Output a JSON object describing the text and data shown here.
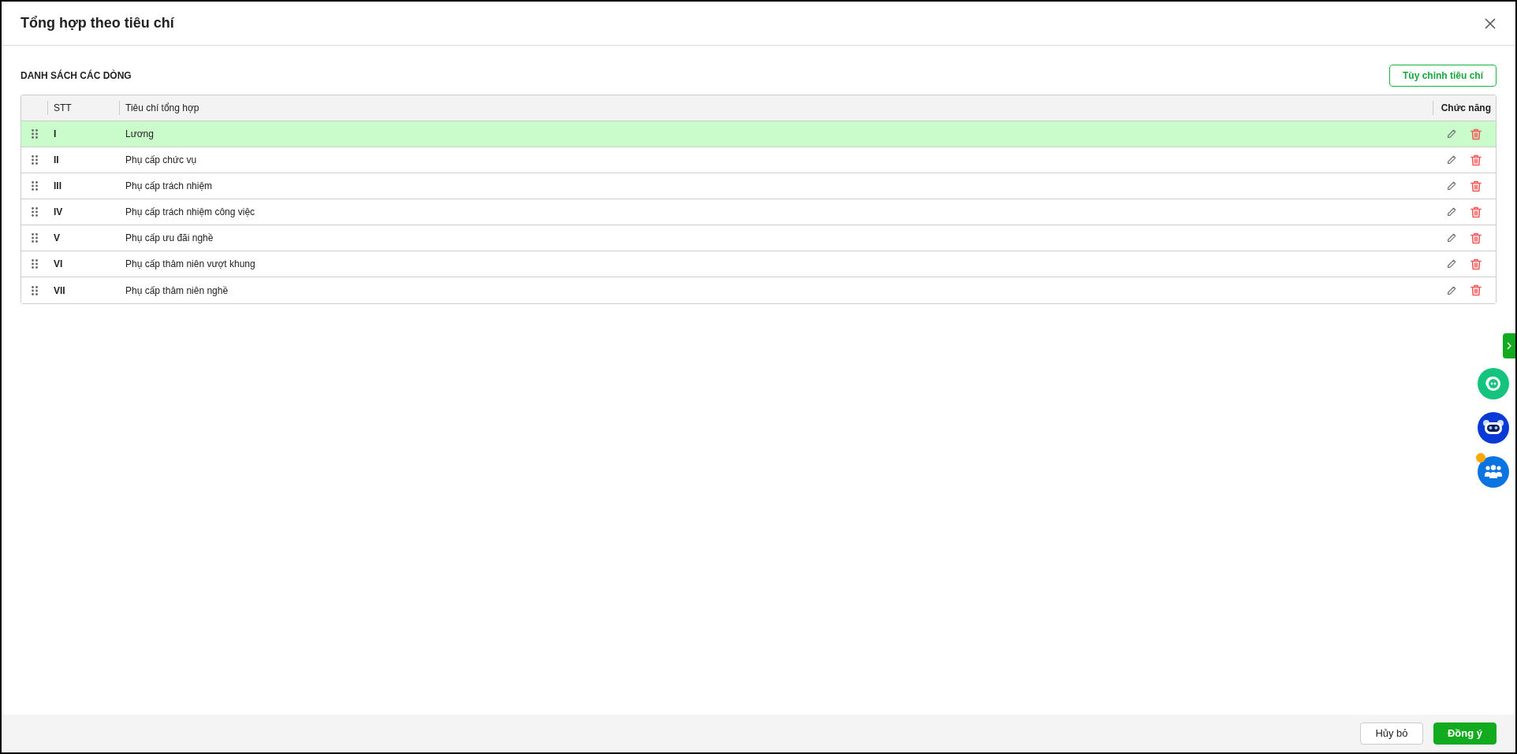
{
  "dialog": {
    "title": "Tổng hợp theo tiêu chí"
  },
  "section": {
    "title": "DANH SÁCH CÁC DÒNG",
    "action": "Tùy chỉnh tiêu chí"
  },
  "table": {
    "columns": [
      "STT",
      "Tiêu chí tổng hợp",
      "Chức năng"
    ],
    "rows": [
      {
        "stt": "I",
        "name": "Lương",
        "selected": true
      },
      {
        "stt": "II",
        "name": "Phụ cấp chức vụ",
        "selected": false
      },
      {
        "stt": "III",
        "name": "Phụ cấp trách nhiệm",
        "selected": false
      },
      {
        "stt": "IV",
        "name": "Phụ cấp trách nhiệm công việc",
        "selected": false
      },
      {
        "stt": "V",
        "name": "Phụ cấp ưu đãi nghề",
        "selected": false
      },
      {
        "stt": "VI",
        "name": "Phụ cấp thâm niên vượt khung",
        "selected": false
      },
      {
        "stt": "VII",
        "name": "Phụ cấp thâm niên nghề",
        "selected": false
      }
    ]
  },
  "footer": {
    "buttons": [
      {
        "label": "Hủy bỏ",
        "kind": "secondary"
      },
      {
        "label": "Đồng ý",
        "kind": "primary"
      }
    ]
  },
  "floating": [
    {
      "kind": "chat"
    },
    {
      "kind": "robot"
    },
    {
      "kind": "group",
      "badge": true
    }
  ]
}
